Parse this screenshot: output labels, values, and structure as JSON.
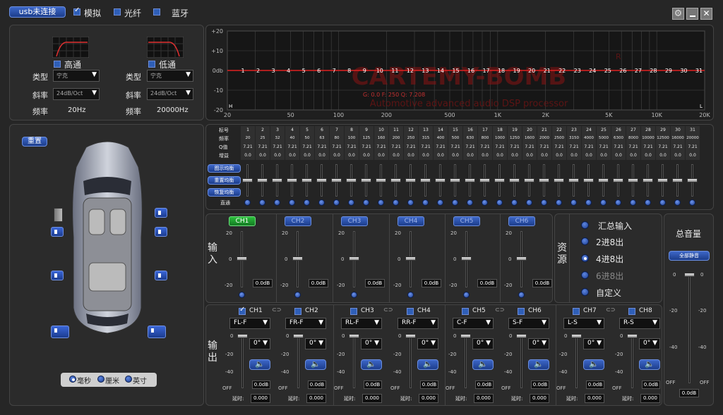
{
  "topbar": {
    "usb_label": "usb未连接",
    "opt_analog": "模拟",
    "opt_fiber": "光纤",
    "opt_bt": "蓝牙"
  },
  "crossover": {
    "high": {
      "title": "高通",
      "type_label": "类型",
      "type_value": "宁克",
      "slope_label": "斜率",
      "slope_value": "24dB/Oct",
      "freq_label": "频率",
      "freq_value": "20Hz"
    },
    "low": {
      "title": "低通",
      "type_label": "类型",
      "type_value": "宁克",
      "slope_label": "斜率",
      "slope_value": "24dB/Oct",
      "freq_label": "频率",
      "freq_value": "20000Hz"
    }
  },
  "eq_graph": {
    "y_labels": [
      "+20",
      "+10",
      "0db",
      "-10",
      "-20"
    ],
    "x_labels": [
      "20",
      "50",
      "100",
      "200",
      "500",
      "1K",
      "2K",
      "5K",
      "10K",
      "20K"
    ],
    "band_numbers": [
      "1",
      "2",
      "3",
      "4",
      "5",
      "6",
      "7",
      "8",
      "9",
      "10",
      "11",
      "12",
      "13",
      "14",
      "15",
      "16",
      "17",
      "18",
      "19",
      "20",
      "21",
      "22",
      "23",
      "24",
      "25",
      "26",
      "27",
      "28",
      "29",
      "30",
      "31"
    ],
    "watermark": "CARTEMY-BOMB",
    "reg_mark": "R",
    "subtitle": "Automotive advanced audio DSP processor",
    "info": "G: 0.0  F: 250  Q: 7.208",
    "corner_h": "H",
    "corner_l": "L"
  },
  "eq_table": {
    "row_labels": [
      "标号",
      "频率",
      "Q值",
      "增益"
    ],
    "freqs": [
      "20",
      "25",
      "32",
      "40",
      "50",
      "63",
      "80",
      "100",
      "125",
      "160",
      "200",
      "250",
      "315",
      "400",
      "500",
      "630",
      "800",
      "1000",
      "1250",
      "1600",
      "2000",
      "2500",
      "3150",
      "4000",
      "5000",
      "6300",
      "8000",
      "10000",
      "12500",
      "16000",
      "20000"
    ],
    "q": "7.21",
    "gain": "0.0",
    "btn_graphic": "图示均衡",
    "btn_reset": "重置均衡",
    "btn_restore": "恢复均衡",
    "direct": "直通"
  },
  "car_panel": {
    "reset": "重置",
    "unit_ms": "毫秒",
    "unit_cm": "厘米",
    "unit_inch": "英寸"
  },
  "input": {
    "label": "输入",
    "channels": [
      "CH1",
      "CH2",
      "CH3",
      "CH4",
      "CH5",
      "CH6"
    ],
    "ticks": [
      "20",
      "0",
      "-20"
    ],
    "value": "0.0dB"
  },
  "source": {
    "label": "资源",
    "options": [
      "汇总输入",
      "2进8出",
      "4进8出",
      "6进8出",
      "自定义"
    ]
  },
  "master": {
    "title": "总音量",
    "mute_all": "全部静音",
    "ticks": [
      "0",
      "-20",
      "-40",
      "OFF"
    ],
    "value": "0.0dB"
  },
  "output": {
    "label": "输出",
    "channels": [
      {
        "name": "CH1",
        "preset": "FL-F"
      },
      {
        "name": "CH2",
        "preset": "FR-F"
      },
      {
        "name": "CH3",
        "preset": "RL-F"
      },
      {
        "name": "CH4",
        "preset": "RR-F"
      },
      {
        "name": "CH5",
        "preset": "C-F"
      },
      {
        "name": "CH6",
        "preset": "S-F"
      },
      {
        "name": "CH7",
        "preset": "L-S"
      },
      {
        "name": "CH8",
        "preset": "R-S"
      }
    ],
    "ticks": [
      "0",
      "-20",
      "-40",
      "OFF"
    ],
    "phase": "0°",
    "value": "0.0dB",
    "delay_label": "延时:",
    "delay_value": "0.000",
    "link": "⊂⊃"
  }
}
